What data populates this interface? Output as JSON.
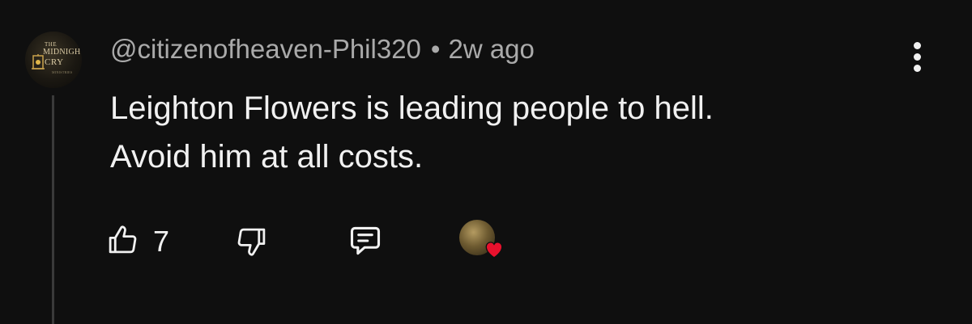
{
  "comment": {
    "author": "@citizenofheaven-Phil320",
    "separator": "•",
    "time_ago": "2w ago",
    "text_lines": [
      "Leighton Flowers is leading people to hell.",
      "Avoid him at all costs."
    ],
    "avatar": {
      "line1": "THE",
      "line2": "MIDNIGHT",
      "line3": "CRY",
      "line4": "MINISTRIES"
    }
  },
  "actions": {
    "like_icon": "thumbs-up-icon",
    "like_count": "7",
    "dislike_icon": "thumbs-down-icon",
    "reply_icon": "comment-bubble-icon",
    "menu_icon": "more-vert-icon",
    "creator_heart_icon": "creator-heart-icon"
  },
  "colors": {
    "background": "#0f0f0f",
    "text_primary": "#f1f1f1",
    "text_secondary": "#aaaaaa",
    "heart": "#e8112d"
  }
}
